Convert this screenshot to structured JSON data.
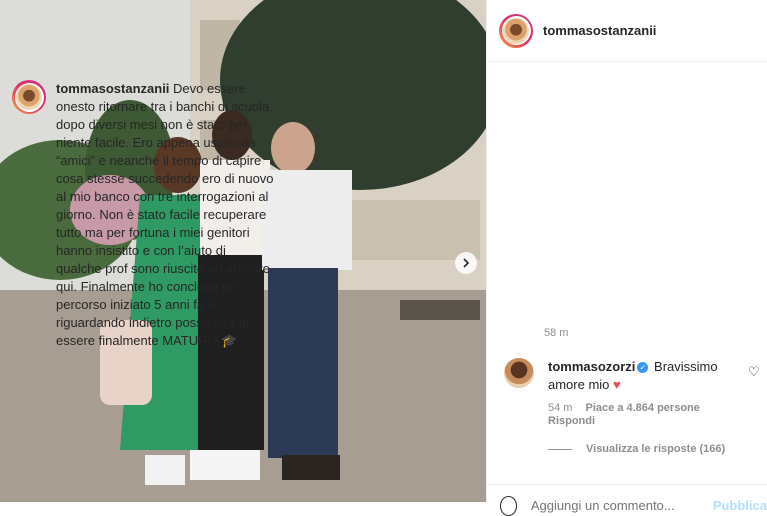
{
  "post": {
    "username": "tommasostanzanii",
    "caption_text": "Devo essere onesto ritornare tra i banchi di scuola dopo diversi mesi non è stato per niente facile. Ero appena uscito da “amici” e neanche il tempo di capire cosa stesse succedendo ero di nuovo al mio banco con tre interrogazioni al giorno. Non è stato facile recuperare tutto ma per fortuna i miei genitori hanno insistito e con l’aiuto di qualche prof sono riuscito ad arrivare qui. Finalmente ho concluso un percorso iniziato 5 anni fa e riguardando indietro posso dire di essere finalmente MATURO 🎓",
    "caption_time": "58 m"
  },
  "comment": {
    "username": "tommasozorzi",
    "text": "Bravissimo amore mio",
    "emoji": "♥",
    "time": "54 m",
    "likes": "Piace a 4.864 persone",
    "reply": "Rispondi",
    "view_replies": "Visualizza le risposte (166)"
  },
  "footer": {
    "placeholder": "Aggiungi un commento...",
    "publish": "Pubblica"
  },
  "icons": {
    "next": "chevron-right-icon",
    "like": "heart-outline-icon",
    "emoji": "smiley-icon"
  },
  "colors": {
    "accent_blue": "#3897f0",
    "publish_disabled": "#b2dffc",
    "heart_red": "#ed4956"
  }
}
